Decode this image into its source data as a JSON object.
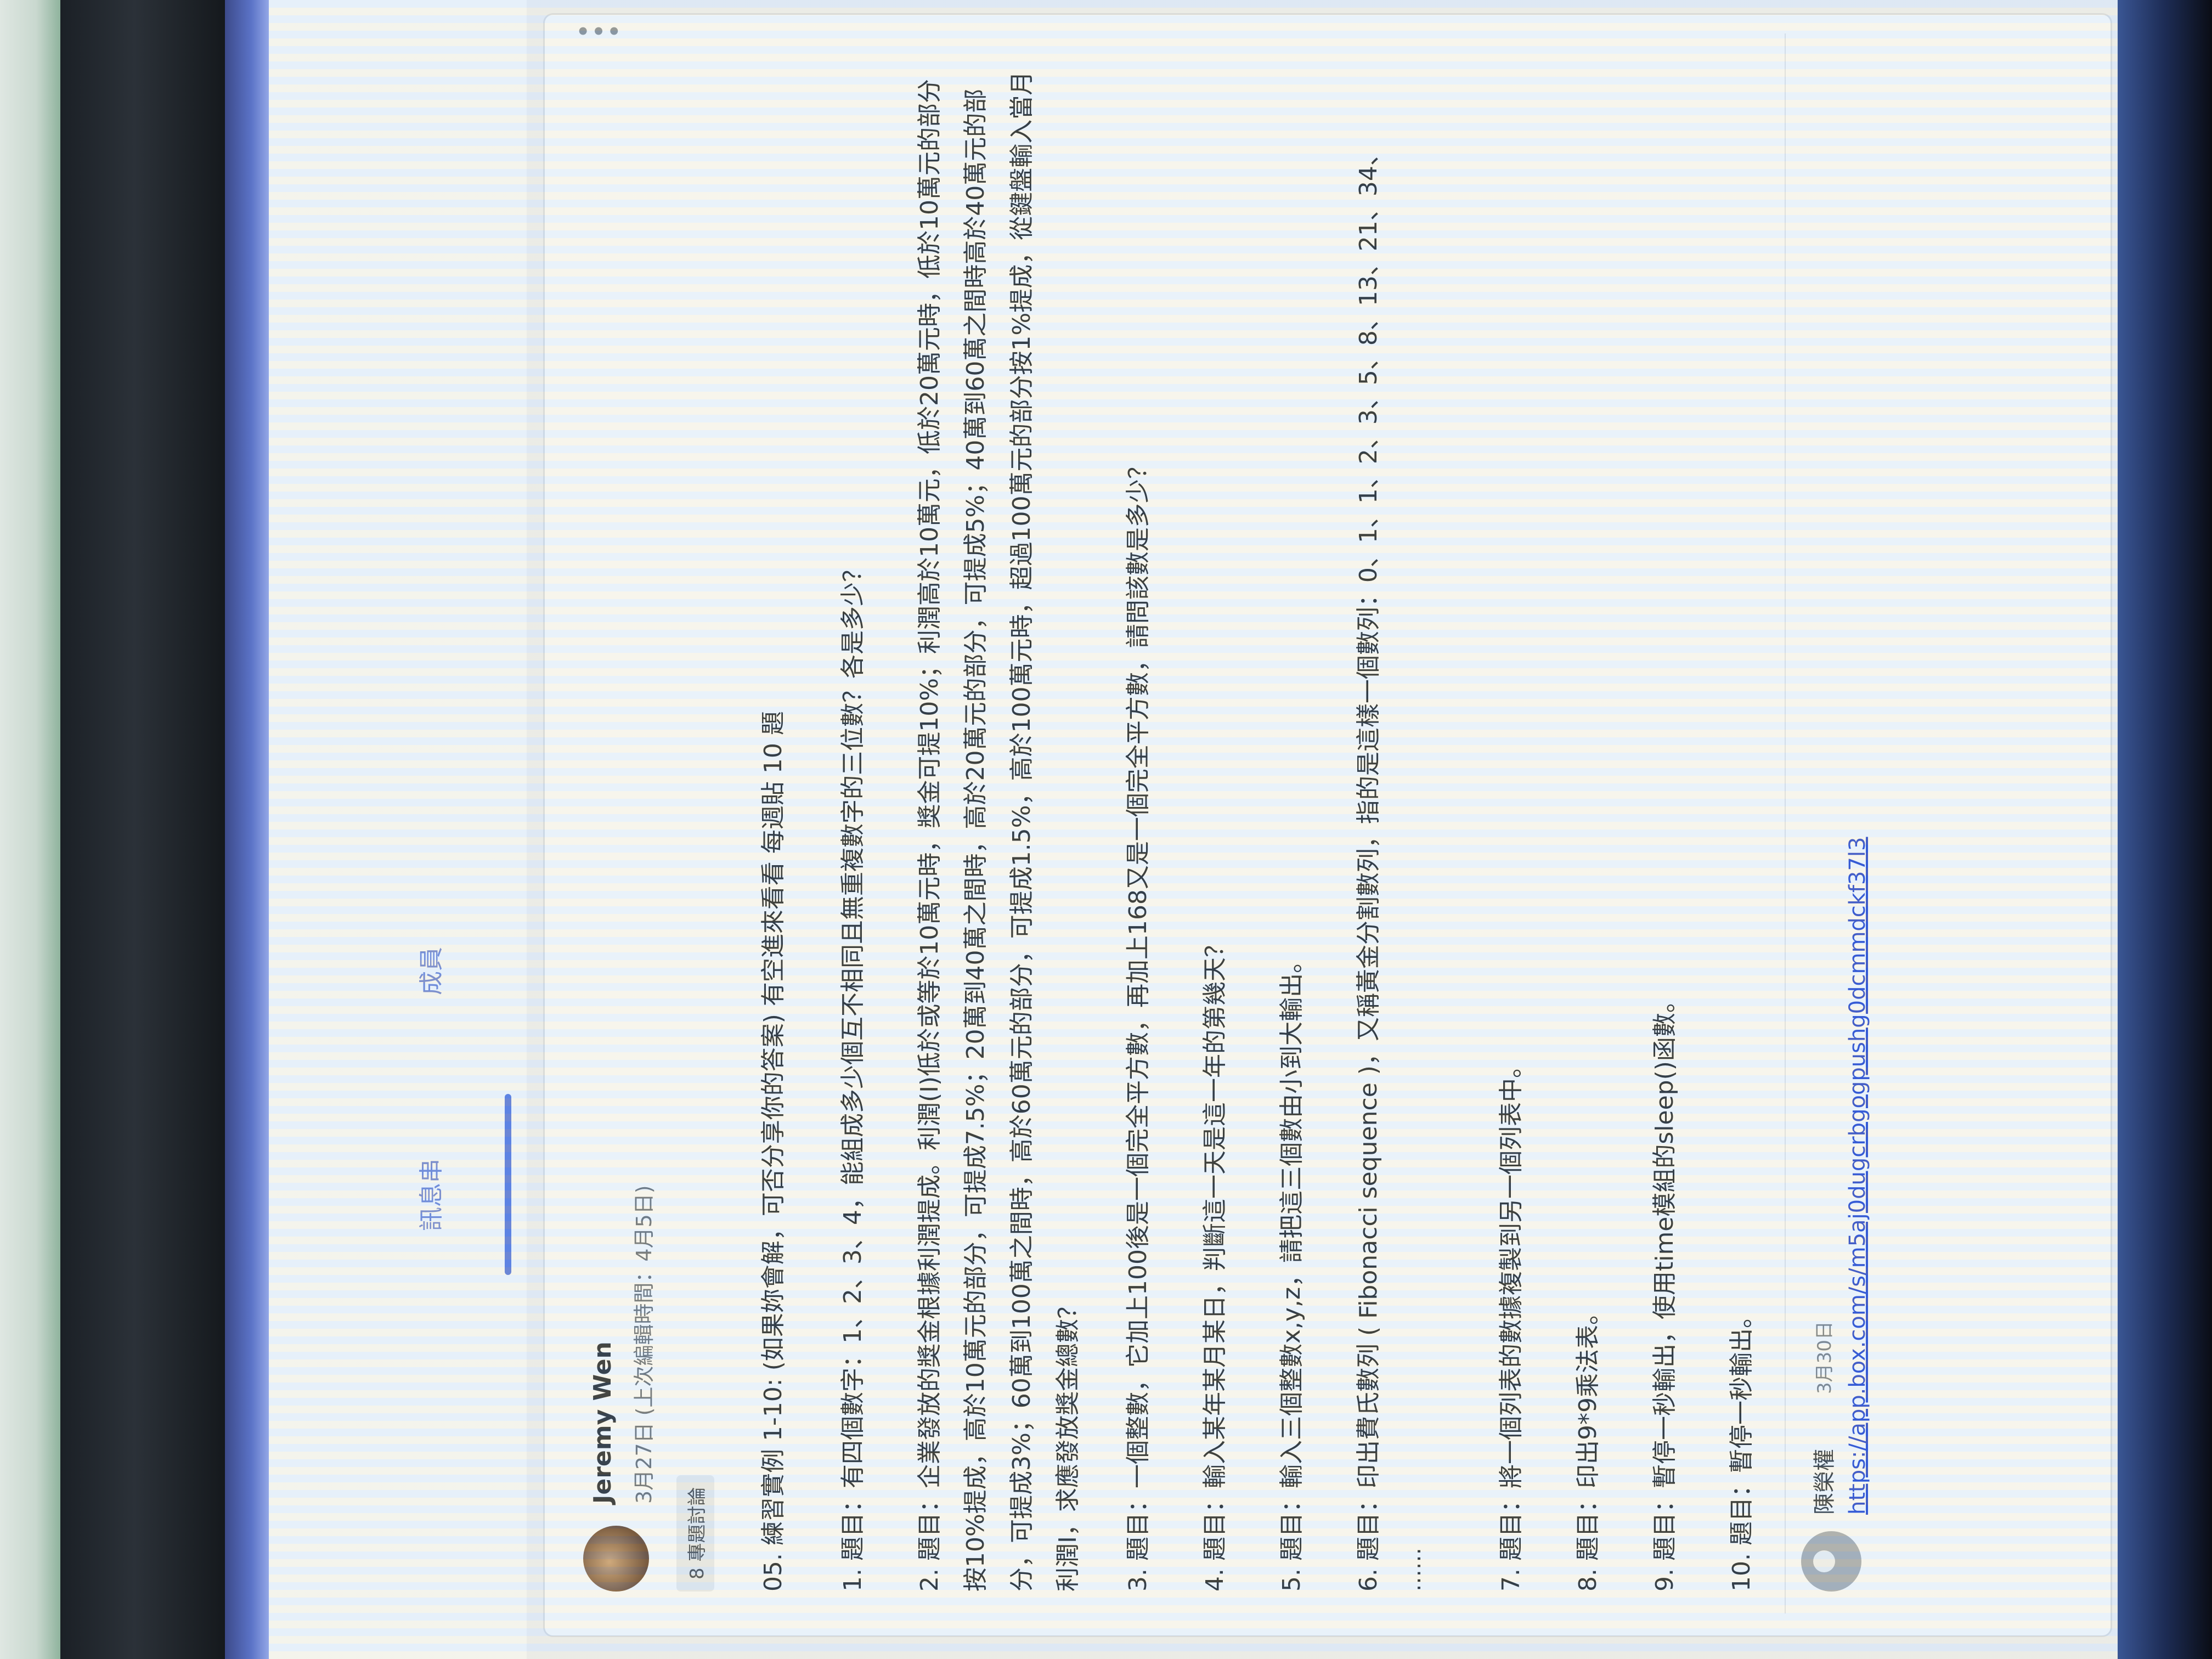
{
  "nav": {
    "tab_stream": "訊息串",
    "tab_members": "成員"
  },
  "post": {
    "author": "Jeremy Wen",
    "date": "3月27日 (上次編輯時間：4月5日)",
    "topic_chip": "8 專題討論",
    "title": "05. 練習實例 1-10: (如果妳會解，可否分享你的答案) 有空進來看看 每週貼 10 題",
    "questions": [
      "1. 題目：有四個數字：1、2、3、4，能組成多少個互不相同且無重複數字的三位數？各是多少？",
      "2. 題目：企業發放的獎金根據利潤提成。利潤(I)低於或等於10萬元時，獎金可提10%；利潤高於10萬元，低於20萬元時，低於10萬元的部分按10%提成，高於10萬元的部分，可提成7.5%；20萬到40萬之間時，高於20萬元的部分，可提成5%；40萬到60萬之間時高於40萬元的部分，可提成3%；60萬到100萬之間時，高於60萬元的部分，可提成1.5%，高於100萬元時，超過100萬元的部分按1%提成，從鍵盤輸入當月利潤I，求應發放獎金總數？",
      "3. 題目：一個整數，它加上100後是一個完全平方數，再加上168又是一個完全平方數，請問該數是多少？",
      "4. 題目：輸入某年某月某日，判斷這一天是這一年的第幾天？",
      "5. 題目：輸入三個整數x,y,z，請把這三個數由小到大輸出。",
      "6. 題目：印出費氏數列 ( Fibonacci sequence )，又稱黃金分割數列，指的是這樣一個數列：0、1、1、2、3、5、8、13、21、34、",
      "7. 題目：將一個列表的數據複製到另一個列表中。",
      "8. 題目：印出9*9乘法表。",
      "9. 題目：暫停一秒輸出，使用time模組的sleep()函數。",
      "10. 題目：暫停一秒輸出。"
    ],
    "ellipsis": "……"
  },
  "comment": {
    "author": "陳榮權",
    "date": "3月30日",
    "link": "https://app.box.com/s/m5aj0dugcrbgogpushg0dcmmdckf37l3"
  },
  "colors": {
    "accent": "#5a7be0",
    "link": "#2f4fd0"
  },
  "icons": [
    "more-vert-icon",
    "avatar",
    "commenter-avatar"
  ]
}
